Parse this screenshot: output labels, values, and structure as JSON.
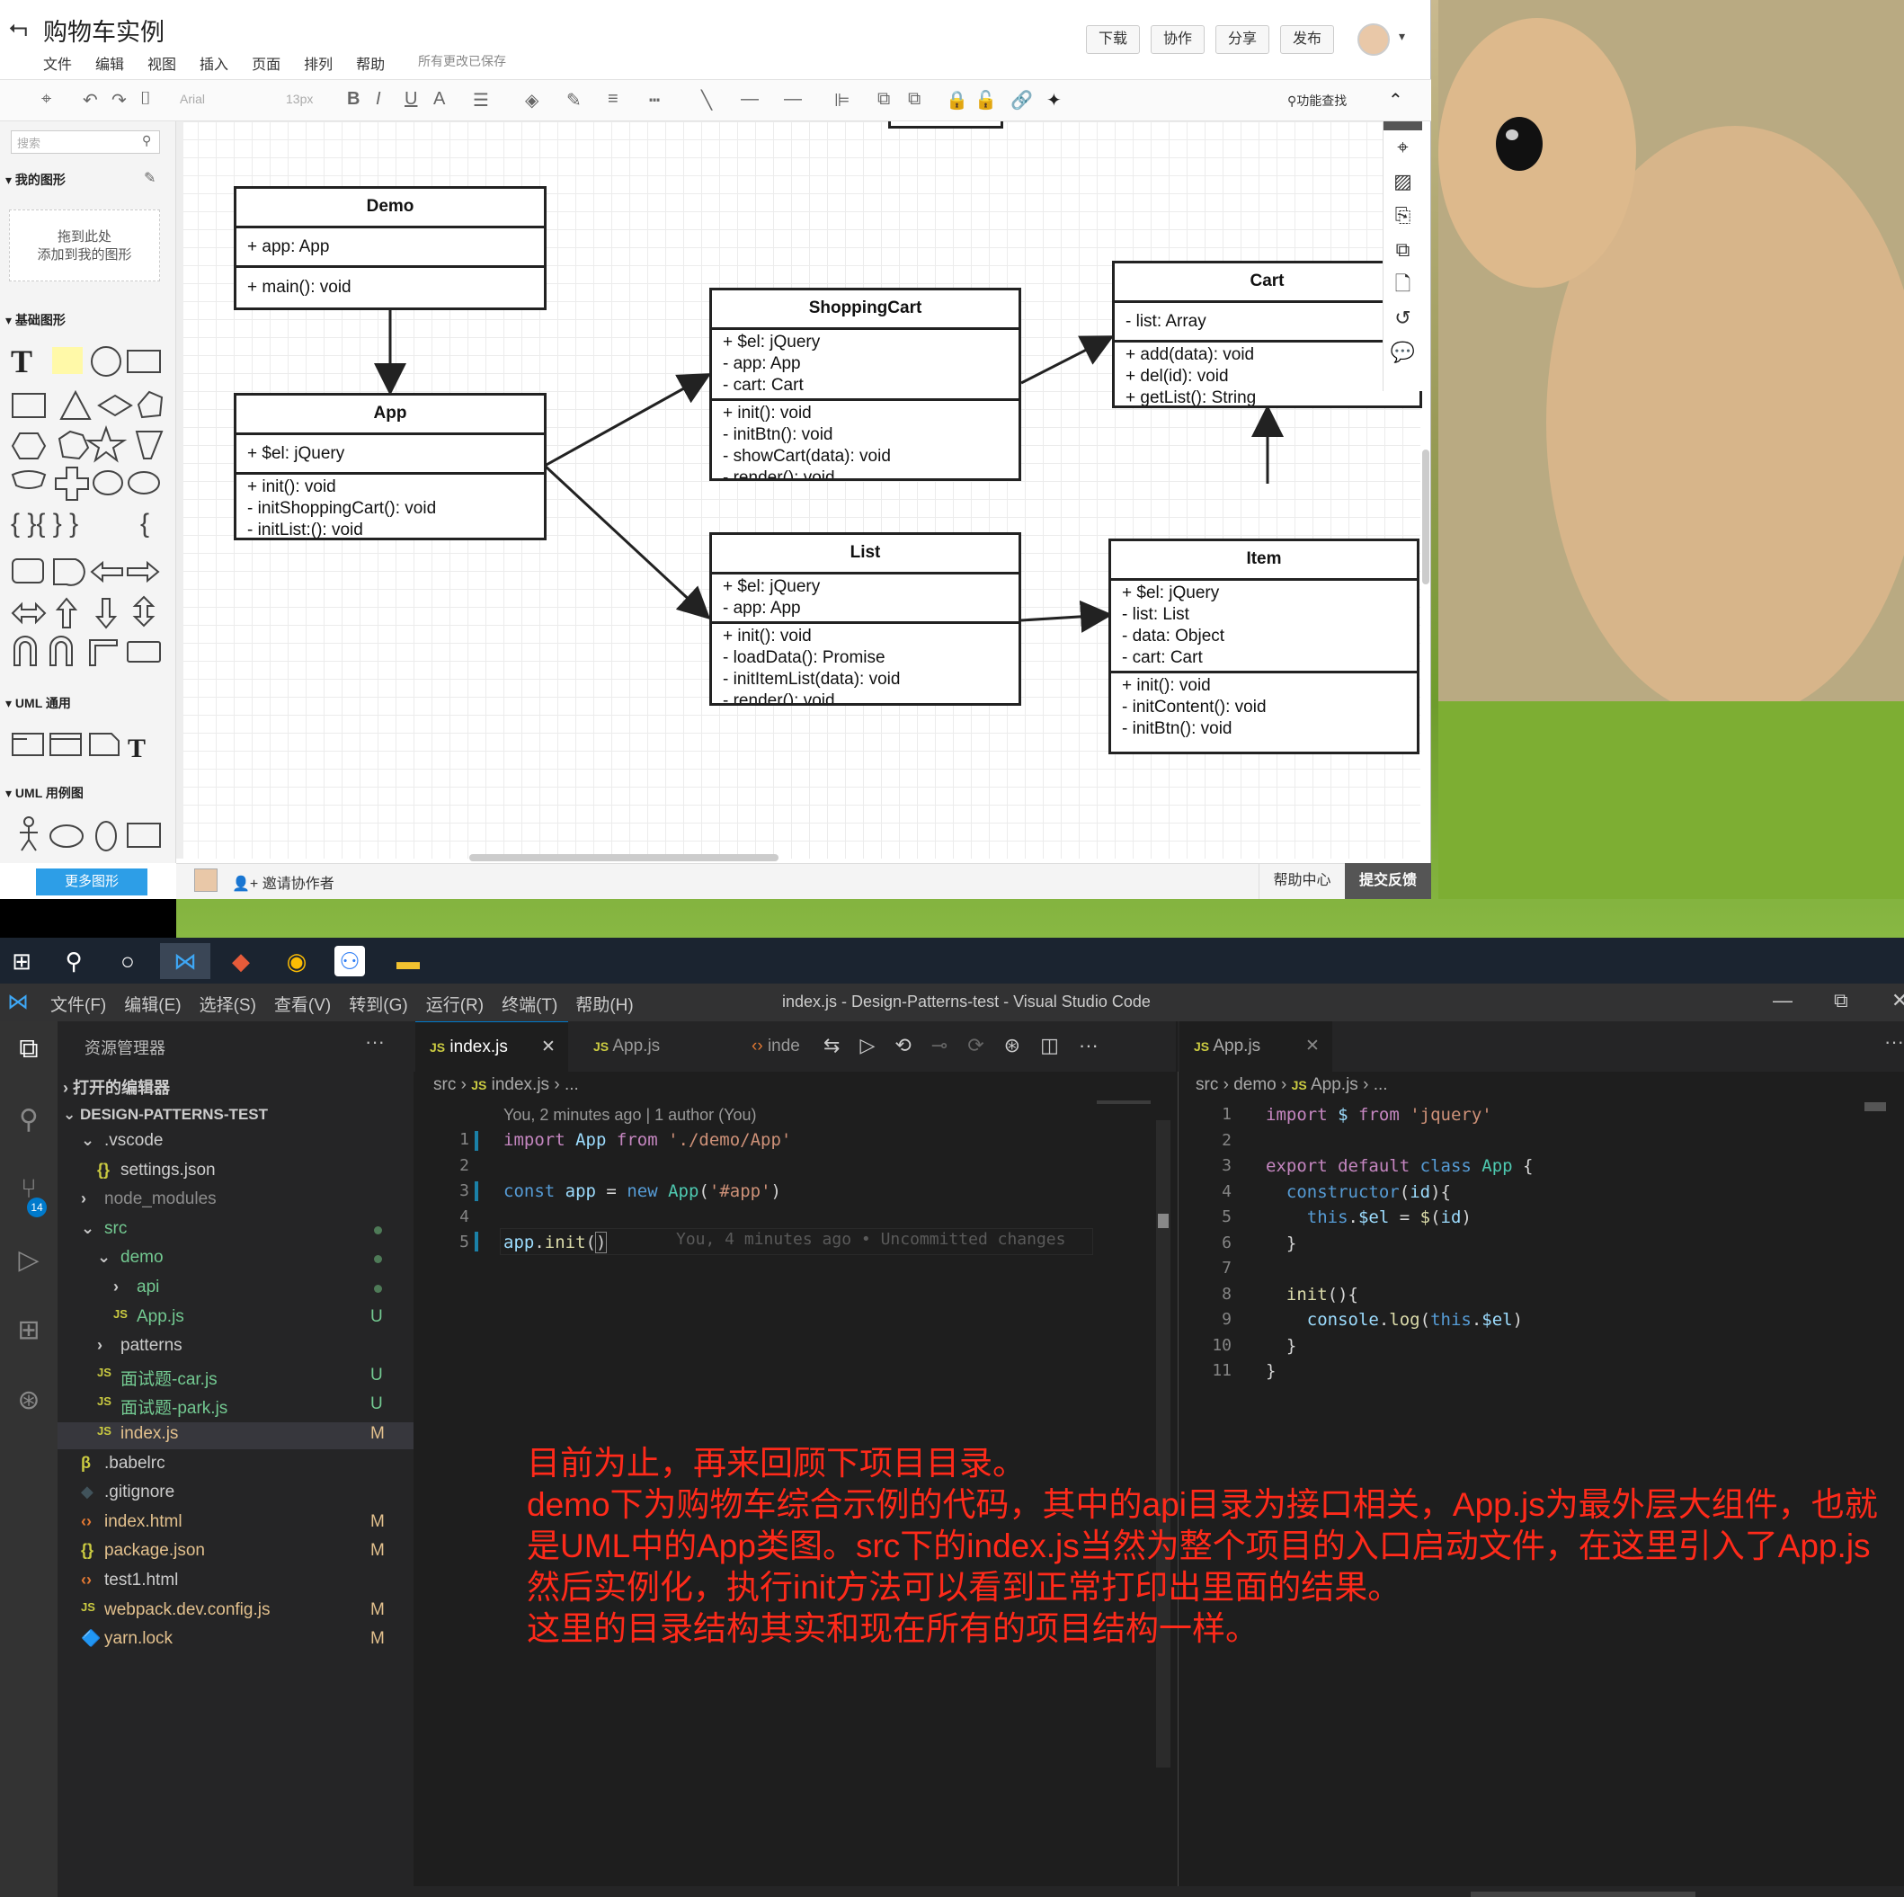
{
  "drawio": {
    "title": "购物车实例",
    "menu": [
      "文件",
      "编辑",
      "视图",
      "插入",
      "页面",
      "排列",
      "帮助"
    ],
    "saved": "所有更改已保存",
    "top_buttons": [
      "下载",
      "协作",
      "分享",
      "发布"
    ],
    "toolbar": {
      "font": "Arial",
      "size": "13px",
      "find": "功能查找"
    },
    "sidebar": {
      "search_placeholder": "搜索",
      "my_shapes": "我的图形",
      "drop_hint_1": "拖到此处",
      "drop_hint_2": "添加到我的图形",
      "basic": "基础图形",
      "uml_common": "UML 通用",
      "uml_usecase": "UML 用例图",
      "more": "更多图形"
    },
    "footer": {
      "invite": "邀请协作者",
      "help": "帮助中心",
      "feedback": "提交反馈"
    },
    "classes": {
      "demo": {
        "name": "Demo",
        "fields": [
          "+ app: App"
        ],
        "methods": [
          "+ main(): void"
        ]
      },
      "app": {
        "name": "App",
        "fields": [
          "+ $el: jQuery"
        ],
        "methods": [
          "+ init(): void",
          "- initShoppingCart(): void",
          "- initList:(): void"
        ]
      },
      "shopping_cart": {
        "name": "ShoppingCart",
        "fields": [
          "+ $el: jQuery",
          "- app: App",
          "- cart: Cart"
        ],
        "methods": [
          "+ init(): void",
          "- initBtn(): void",
          "- showCart(data): void",
          "- render(): void"
        ]
      },
      "cart": {
        "name": "Cart",
        "fields": [
          "- list: Array"
        ],
        "methods": [
          "+ add(data): void",
          "+ del(id): void",
          "+ getList(): String"
        ]
      },
      "list": {
        "name": "List",
        "fields": [
          "+ $el: jQuery",
          "- app: App"
        ],
        "methods": [
          "+ init(): void",
          "- loadData(): Promise",
          "- initItemList(data): void",
          "- render(): void"
        ]
      },
      "item": {
        "name": "Item",
        "fields": [
          "+ $el: jQuery",
          "- list: List",
          "- data: Object",
          "- cart: Cart"
        ],
        "methods": [
          "+ init(): void",
          "- initContent(): void",
          "- initBtn(): void"
        ]
      }
    }
  },
  "vscode": {
    "menu": [
      "文件(F)",
      "编辑(E)",
      "选择(S)",
      "查看(V)",
      "转到(G)",
      "运行(R)",
      "终端(T)",
      "帮助(H)"
    ],
    "window_title": "index.js - Design-Patterns-test - Visual Studio Code",
    "explorer_title": "资源管理器",
    "open_editors": "打开的编辑器",
    "project": "DESIGN-PATTERNS-TEST",
    "scm_badge": "14",
    "tree": [
      {
        "name": ".vscode",
        "indent": 1,
        "kind": "folder-open",
        "status": ""
      },
      {
        "name": "settings.json",
        "indent": 2,
        "kind": "json",
        "status": ""
      },
      {
        "name": "node_modules",
        "indent": 1,
        "kind": "folder",
        "status": ""
      },
      {
        "name": "src",
        "indent": 1,
        "kind": "folder-open",
        "status": "dot"
      },
      {
        "name": "demo",
        "indent": 2,
        "kind": "folder-open",
        "status": "dot"
      },
      {
        "name": "api",
        "indent": 3,
        "kind": "folder",
        "status": "dot"
      },
      {
        "name": "App.js",
        "indent": 3,
        "kind": "js",
        "status": "U"
      },
      {
        "name": "patterns",
        "indent": 2,
        "kind": "folder",
        "status": ""
      },
      {
        "name": "面试题-car.js",
        "indent": 2,
        "kind": "js",
        "status": "U"
      },
      {
        "name": "面试题-park.js",
        "indent": 2,
        "kind": "js",
        "status": "U"
      },
      {
        "name": "index.js",
        "indent": 2,
        "kind": "js",
        "status": "M"
      },
      {
        "name": ".babelrc",
        "indent": 1,
        "kind": "babel",
        "status": ""
      },
      {
        "name": ".gitignore",
        "indent": 1,
        "kind": "git",
        "status": ""
      },
      {
        "name": "index.html",
        "indent": 1,
        "kind": "html",
        "status": "M"
      },
      {
        "name": "package.json",
        "indent": 1,
        "kind": "json",
        "status": "M"
      },
      {
        "name": "test1.html",
        "indent": 1,
        "kind": "html",
        "status": ""
      },
      {
        "name": "webpack.dev.config.js",
        "indent": 1,
        "kind": "js",
        "status": "M"
      },
      {
        "name": "yarn.lock",
        "indent": 1,
        "kind": "yarn",
        "status": "M"
      }
    ],
    "left_editor": {
      "tabs": [
        "index.js",
        "App.js",
        "inde"
      ],
      "breadcrumb": [
        "src",
        "index.js",
        "..."
      ],
      "blame": "You, 2 minutes ago | 1 author (You)",
      "inline_blame": "You, 4 minutes ago • Uncommitted changes",
      "line_numbers": [
        "1",
        "2",
        "3",
        "4",
        "5"
      ]
    },
    "right_editor": {
      "tab": "App.js",
      "breadcrumb": [
        "src",
        "demo",
        "App.js",
        "..."
      ],
      "line_numbers": [
        "1",
        "2",
        "3",
        "4",
        "5",
        "6",
        "7",
        "8",
        "9",
        "10",
        "11"
      ]
    }
  },
  "annotation": "目前为止，再来回顾下项目目录。\ndemo下为购物车综合示例的代码，其中的api目录为接口相关，App.js为最外层大组件，也就是UML中的App类图。src下的index.js当然为整个项目的入口启动文件，在这里引入了App.js然后实例化，执行init方法可以看到正常打印出里面的结果。\n这里的目录结构其实和现在所有的项目结构一样。"
}
